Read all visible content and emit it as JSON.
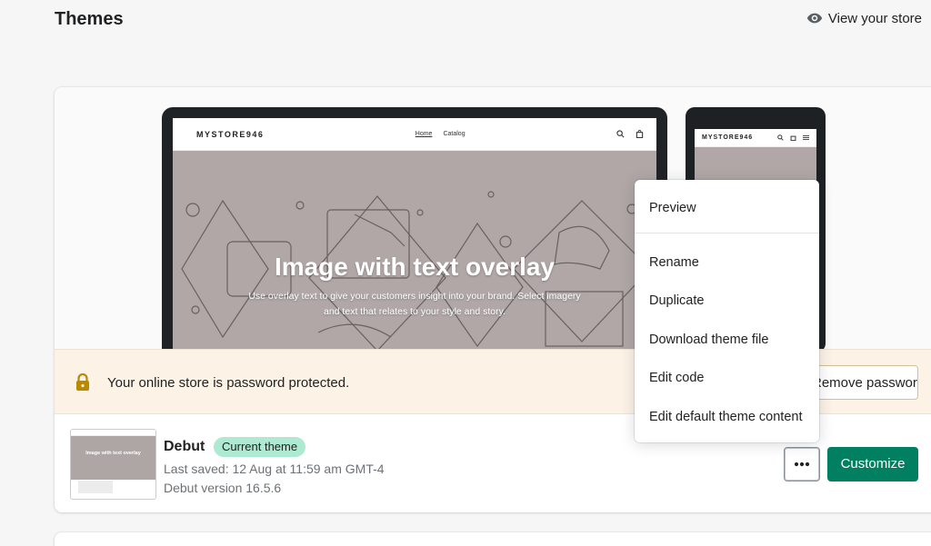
{
  "header": {
    "title": "Themes",
    "view_store_label": "View your store",
    "view_store_icon": "eye-icon"
  },
  "preview": {
    "desktop": {
      "store_name": "MYSTORE946",
      "nav": [
        "Home",
        "Catalog"
      ],
      "hero_title": "Image with text overlay",
      "hero_subtitle": "Use overlay text to give your customers insight into your brand. Select imagery and text that relates to your style and story."
    },
    "mobile": {
      "store_name": "MYSTORE946"
    }
  },
  "banner": {
    "icon": "lock-icon",
    "text": "Your online store is password protected.",
    "button_label": "Remove password"
  },
  "theme": {
    "thumbnail_text": "Image with text overlay",
    "name": "Debut",
    "badge": "Current theme",
    "last_saved": "Last saved: 12 Aug at 11:59 am GMT-4",
    "version": "Debut version 16.5.6",
    "more_icon": "more-horizontal-icon",
    "customize_label": "Customize"
  },
  "menu": {
    "items": [
      "Preview",
      "Rename",
      "Duplicate",
      "Download theme file",
      "Edit code",
      "Edit default theme content"
    ]
  },
  "colors": {
    "primary": "#008060",
    "badge": "#aee9d1",
    "banner_bg": "#fdf2e6",
    "lock": "#b98900"
  }
}
